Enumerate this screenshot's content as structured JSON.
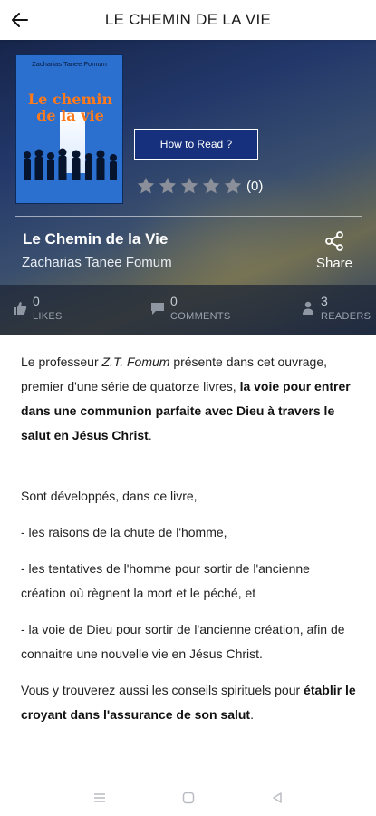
{
  "header": {
    "title": "LE CHEMIN DE LA VIE",
    "back_icon": "arrow-left-icon"
  },
  "cover": {
    "author": "Zacharias Tanee Fomum",
    "title_line1": "Le chemin",
    "title_line2": "de la vie"
  },
  "actions": {
    "how_to_read": "How to Read ?"
  },
  "rating": {
    "stars": 0,
    "max": 5,
    "count": "(0)"
  },
  "book": {
    "title": "Le Chemin de la Vie",
    "author": "Zacharias Tanee Fomum",
    "share_label": "Share"
  },
  "stats": {
    "likes": {
      "count": "0",
      "label": "LIKES"
    },
    "comments": {
      "count": "0",
      "label": "COMMENTS"
    },
    "readers": {
      "count": "3",
      "label": "READERS"
    }
  },
  "description": {
    "p1_a": "Le professeur ",
    "p1_author": "Z.T. Fomum",
    "p1_b": " présente dans cet ouvrage, premier d'une série de quatorze livres, ",
    "p1_bold": "la voie pour entrer dans une communion parfaite avec Dieu à travers le salut en Jésus Christ",
    "p1_end": ".",
    "p2": "Sont développés, dans ce livre,",
    "p3": "- les raisons de la chute de l'homme,",
    "p4": "- les tentatives de l'homme pour sortir de l'ancienne création où règnent la mort et le péché, et",
    "p5": "- la voie de Dieu pour sortir de l'ancienne création, afin de connaitre une nouvelle vie en Jésus Christ.",
    "p6_a": "Vous y trouverez aussi les conseils spirituels pour ",
    "p6_bold": "établir le croyant dans l'assurance de son salut",
    "p6_end": "."
  },
  "colors": {
    "accent": "#16307e",
    "hero_dark": "#16254a",
    "star_empty": "#8a8f99"
  }
}
